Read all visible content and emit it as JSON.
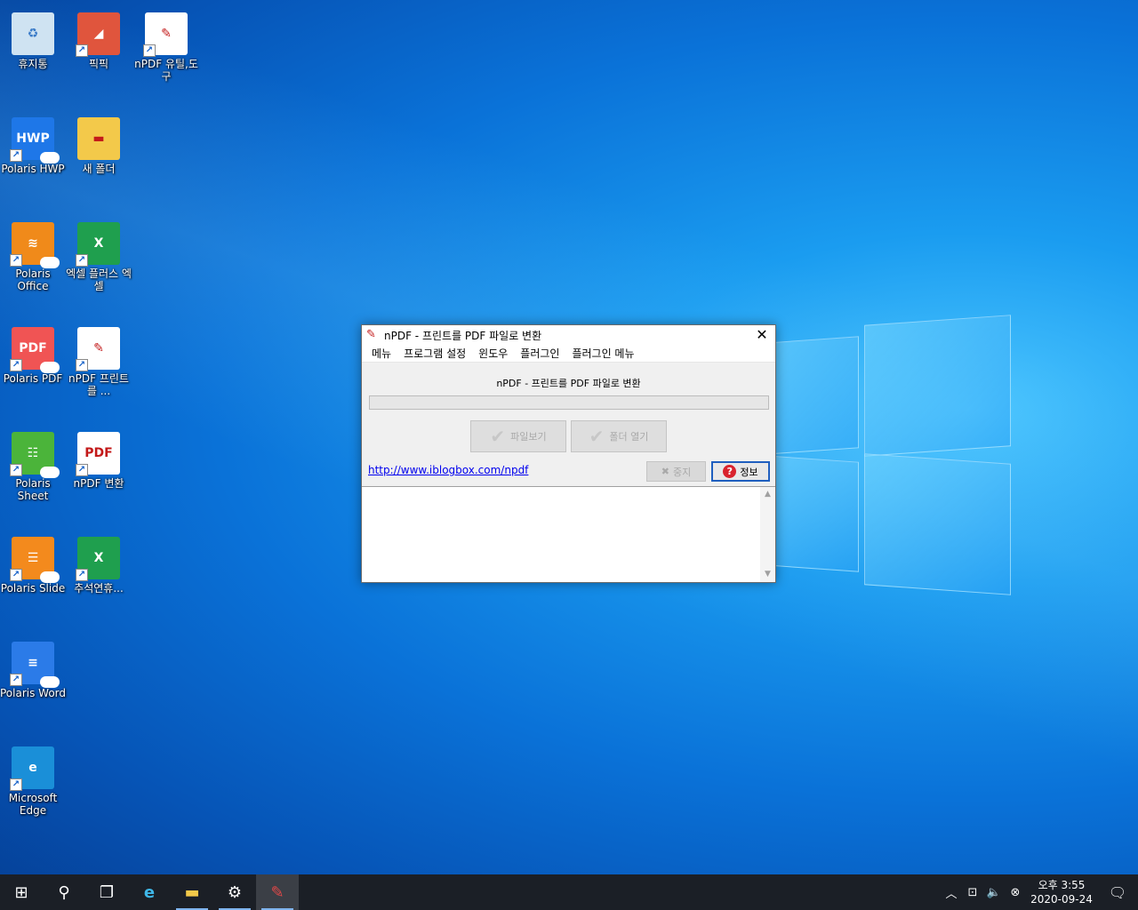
{
  "desktop_icons": [
    {
      "label": "휴지통",
      "glyph": "♻",
      "color": "#cfe3f2"
    },
    {
      "label": "픽픽",
      "glyph": "◢",
      "color": "#e0553d"
    },
    {
      "label": "nPDF 유틸,도구",
      "glyph": "✎",
      "color": "#ffffff"
    },
    {
      "label": "Polaris HWP",
      "glyph": "HWP",
      "color": "#1e77e8"
    },
    {
      "label": "새 폴더",
      "glyph": "▬",
      "color": "#f3c94a"
    },
    {
      "label": "Polaris Office",
      "glyph": "≋",
      "color": "#f08a1a"
    },
    {
      "label": "엑셀 플러스 엑셀",
      "glyph": "X",
      "color": "#1f9f4e"
    },
    {
      "label": "Polaris PDF",
      "glyph": "PDF",
      "color": "#f05454"
    },
    {
      "label": "nPDF 프린트를 ...",
      "glyph": "✎",
      "color": "#ffffff"
    },
    {
      "label": "Polaris Sheet",
      "glyph": "☷",
      "color": "#4bb43a"
    },
    {
      "label": "nPDF 변환",
      "glyph": "PDF",
      "color": "#ffffff"
    },
    {
      "label": "Polaris Slide",
      "glyph": "☰",
      "color": "#f38a1d"
    },
    {
      "label": "추석연휴...",
      "glyph": "X",
      "color": "#1f9f4e"
    },
    {
      "label": "Polaris Word",
      "glyph": "≡",
      "color": "#2b7be8"
    },
    {
      "label": "Microsoft Edge",
      "glyph": "e",
      "color": "#1a8fd8"
    }
  ],
  "dialog": {
    "title": "nPDF - 프린트를 PDF 파일로 변환",
    "menu": [
      "메뉴",
      "프로그램 설정",
      "윈도우",
      "플러그인",
      "플러그인 메뉴"
    ],
    "heading": "nPDF - 프린트를 PDF 파일로 변환",
    "progress": 0,
    "view_file_button": "파일보기",
    "open_folder_button": "폴더 열기",
    "link": "http://www.iblogbox.com/npdf",
    "stop_button": "중지",
    "info_button": "정보",
    "log_text": ""
  },
  "taskbar": {
    "icons": [
      "windows-start-icon",
      "search-icon",
      "task-view-icon",
      "edge-icon",
      "file-explorer-icon",
      "settings-icon",
      "npdf-icon"
    ],
    "clock_time": "오후 3:55",
    "clock_date": "2020-09-24"
  }
}
